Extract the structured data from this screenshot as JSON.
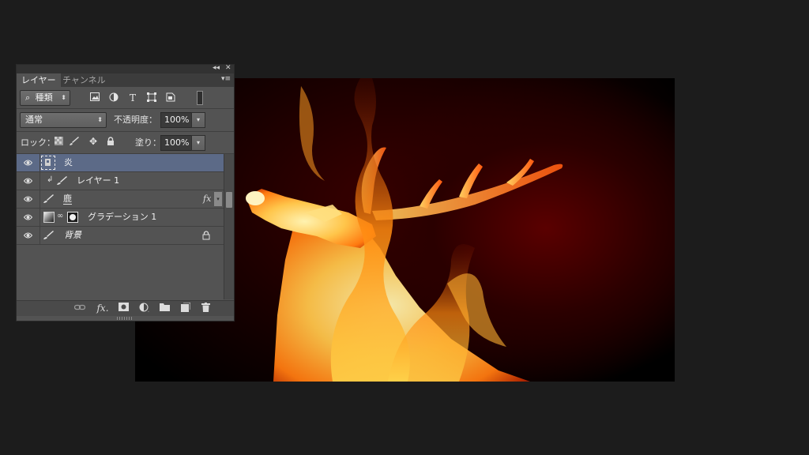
{
  "panel": {
    "collapse_icon": "◂◂",
    "close_icon": "✕",
    "menu_icon": "▾≡",
    "tabs": [
      {
        "label": "レイヤー",
        "active": true
      },
      {
        "label": "チャンネル",
        "active": false
      }
    ]
  },
  "filter": {
    "kind_label": "種類",
    "search_glyph": "⌕",
    "icons": [
      "image-filter-icon",
      "adjustment-filter-icon",
      "type-filter-icon",
      "shape-filter-icon",
      "smart-object-filter-icon",
      "filter-toggle-icon"
    ]
  },
  "blend": {
    "mode": "通常",
    "opacity_label": "不透明度：",
    "opacity_value": "100%"
  },
  "lock": {
    "label": "ロック：",
    "fill_label": "塗り：",
    "fill_value": "100%"
  },
  "layers": [
    {
      "name": "炎",
      "selected": true,
      "type": "smart-object"
    },
    {
      "name": "レイヤー 1",
      "selected": false,
      "type": "clipped-pixel"
    },
    {
      "name": "鹿",
      "selected": false,
      "type": "pixel",
      "fx": "fx"
    },
    {
      "name": "グラデーション 1",
      "selected": false,
      "type": "gradient-fill"
    },
    {
      "name": "背景",
      "selected": false,
      "type": "background",
      "locked": true
    }
  ],
  "colors": {
    "panel_bg": "#535353",
    "selected_row": "#5c6a87",
    "fire_core": "#ffe08a",
    "fire_mid": "#ff9a1a",
    "fire_edge": "#d23a00"
  }
}
